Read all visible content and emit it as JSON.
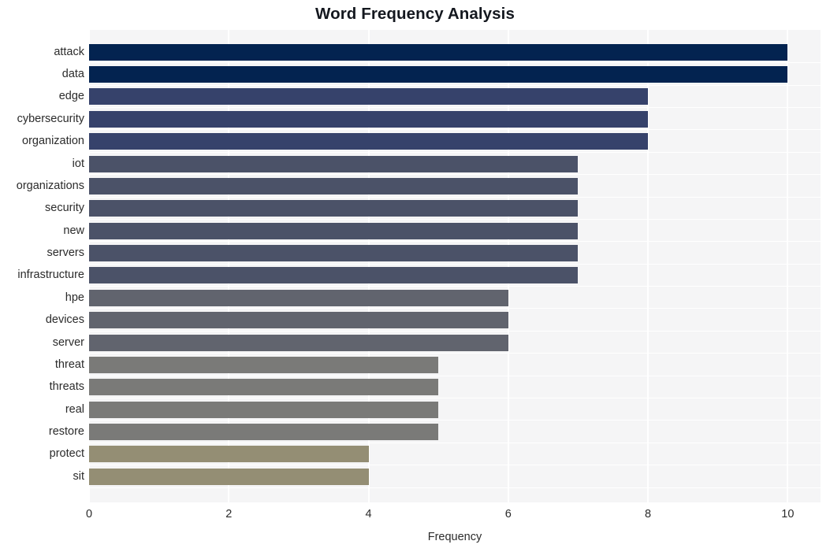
{
  "chart_data": {
    "type": "bar",
    "orientation": "horizontal",
    "title": "Word Frequency Analysis",
    "xlabel": "Frequency",
    "ylabel": "",
    "categories": [
      "attack",
      "data",
      "edge",
      "cybersecurity",
      "organization",
      "iot",
      "organizations",
      "security",
      "new",
      "servers",
      "infrastructure",
      "hpe",
      "devices",
      "server",
      "threat",
      "threats",
      "real",
      "restore",
      "protect",
      "sit"
    ],
    "values": [
      10,
      10,
      8,
      8,
      8,
      7,
      7,
      7,
      7,
      7,
      7,
      6,
      6,
      6,
      5,
      5,
      5,
      5,
      4,
      4
    ],
    "bar_colors": [
      "#032350",
      "#032350",
      "#36426b",
      "#36426b",
      "#36426b",
      "#4b5268",
      "#4b5268",
      "#4b5268",
      "#4b5268",
      "#4b5268",
      "#4b5268",
      "#61646e",
      "#61646e",
      "#61646e",
      "#7a7a78",
      "#7a7a78",
      "#7a7a78",
      "#7a7a78",
      "#948e74",
      "#948e74"
    ],
    "xlim": [
      0,
      10.47
    ],
    "xticks": [
      0,
      2,
      4,
      6,
      8,
      10
    ],
    "xtick_labels": [
      "0",
      "2",
      "4",
      "6",
      "8",
      "10"
    ],
    "grid": true,
    "grid_color": "#ffffff",
    "plot_background": "#f5f5f6",
    "figure_background": "#ffffff",
    "title_color": "#14181f",
    "tick_color": "#2b2b2b",
    "legend": null
  }
}
